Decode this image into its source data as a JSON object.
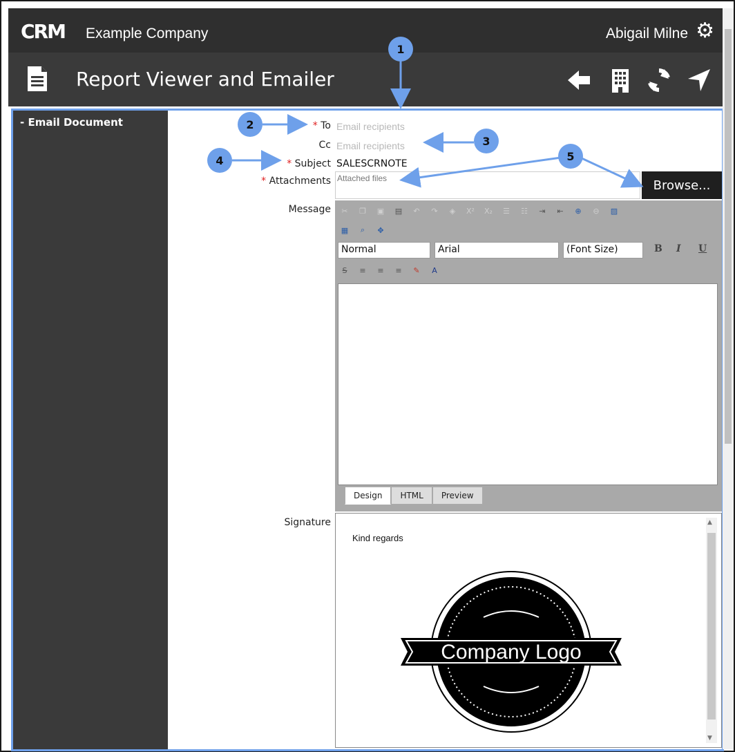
{
  "header": {
    "logo": "CRM",
    "company": "Example Company",
    "user": "Abigail Milne",
    "title": "Report Viewer and Emailer"
  },
  "sidebar": {
    "items": [
      {
        "label": "- Email Document"
      }
    ]
  },
  "form": {
    "to_label": "To",
    "to_placeholder": "Email recipients",
    "cc_label": "Cc",
    "cc_placeholder": "Email recipients",
    "subject_label": "Subject",
    "subject_value": "SALESCRNOTE",
    "attachments_label": "Attachments",
    "attachments_placeholder": "Attached files",
    "browse_label": "Browse...",
    "message_label": "Message",
    "signature_label": "Signature",
    "required_mark": "*"
  },
  "editor": {
    "format": "Normal",
    "font": "Arial",
    "size": "(Font Size)",
    "bold": "B",
    "italic": "I",
    "underline": "U",
    "tabs": [
      "Design",
      "HTML",
      "Preview"
    ],
    "active_tab": "Design"
  },
  "signature": {
    "text": "Kind regards",
    "logo_text": "Company Logo"
  },
  "annotations": [
    "1",
    "2",
    "3",
    "4",
    "5"
  ],
  "colors": {
    "accent": "#6ea0ea",
    "required": "#e02020",
    "bar": "#2f2f2f"
  }
}
